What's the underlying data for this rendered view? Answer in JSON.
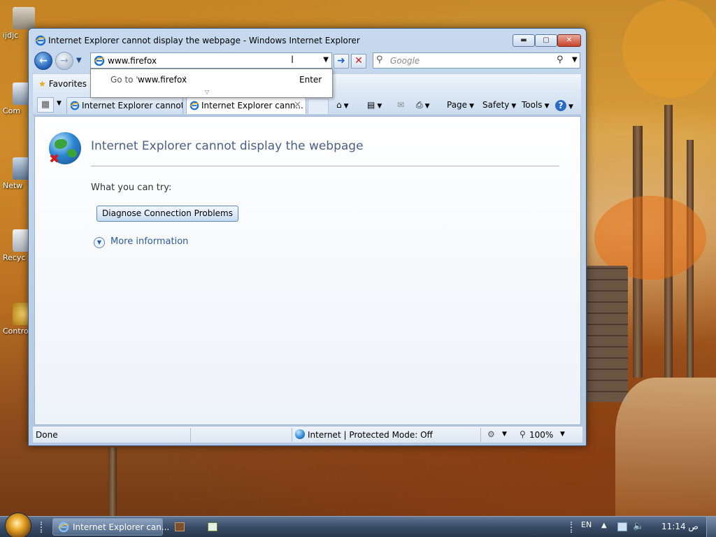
{
  "desktop": {
    "icons": [
      {
        "label": "ijdjc"
      },
      {
        "label": "Com"
      },
      {
        "label": "Netw"
      },
      {
        "label": "Recyc"
      },
      {
        "label": "Contro"
      }
    ]
  },
  "window": {
    "title": "Internet Explorer cannot display the webpage - Windows Internet Explorer",
    "caption": {
      "minimize": "▬",
      "maximize": "▢",
      "close": "✕"
    },
    "address": {
      "value": "www.firefox"
    },
    "autocomplete": {
      "goto_prefix": "Go to '",
      "url": "www.firefox",
      "goto_suffix": "'",
      "enter_label": "Enter"
    },
    "search": {
      "placeholder": "Google"
    },
    "favorites_label": "Favorites",
    "tabs": [
      {
        "label": "Internet Explorer cannot ..."
      },
      {
        "label": "Internet Explorer cann..."
      }
    ],
    "commands": {
      "page": "Page",
      "safety": "Safety",
      "tools": "Tools"
    },
    "content": {
      "title": "Internet Explorer cannot display the webpage",
      "try_label": "What you can try:",
      "diagnose_button": "Diagnose Connection Problems",
      "more_info": "More information"
    },
    "status": {
      "done": "Done",
      "zone": "Internet | Protected Mode: Off",
      "zoom": "100%"
    }
  },
  "taskbar": {
    "active_window": "Internet Explorer can...",
    "language": "EN",
    "clock": "11:14 ص"
  },
  "colors": {
    "title_text": "#4a5f86",
    "link": "#2a5a9a",
    "close_red": "#c7422b",
    "window_frame": "#b3c9e3"
  }
}
